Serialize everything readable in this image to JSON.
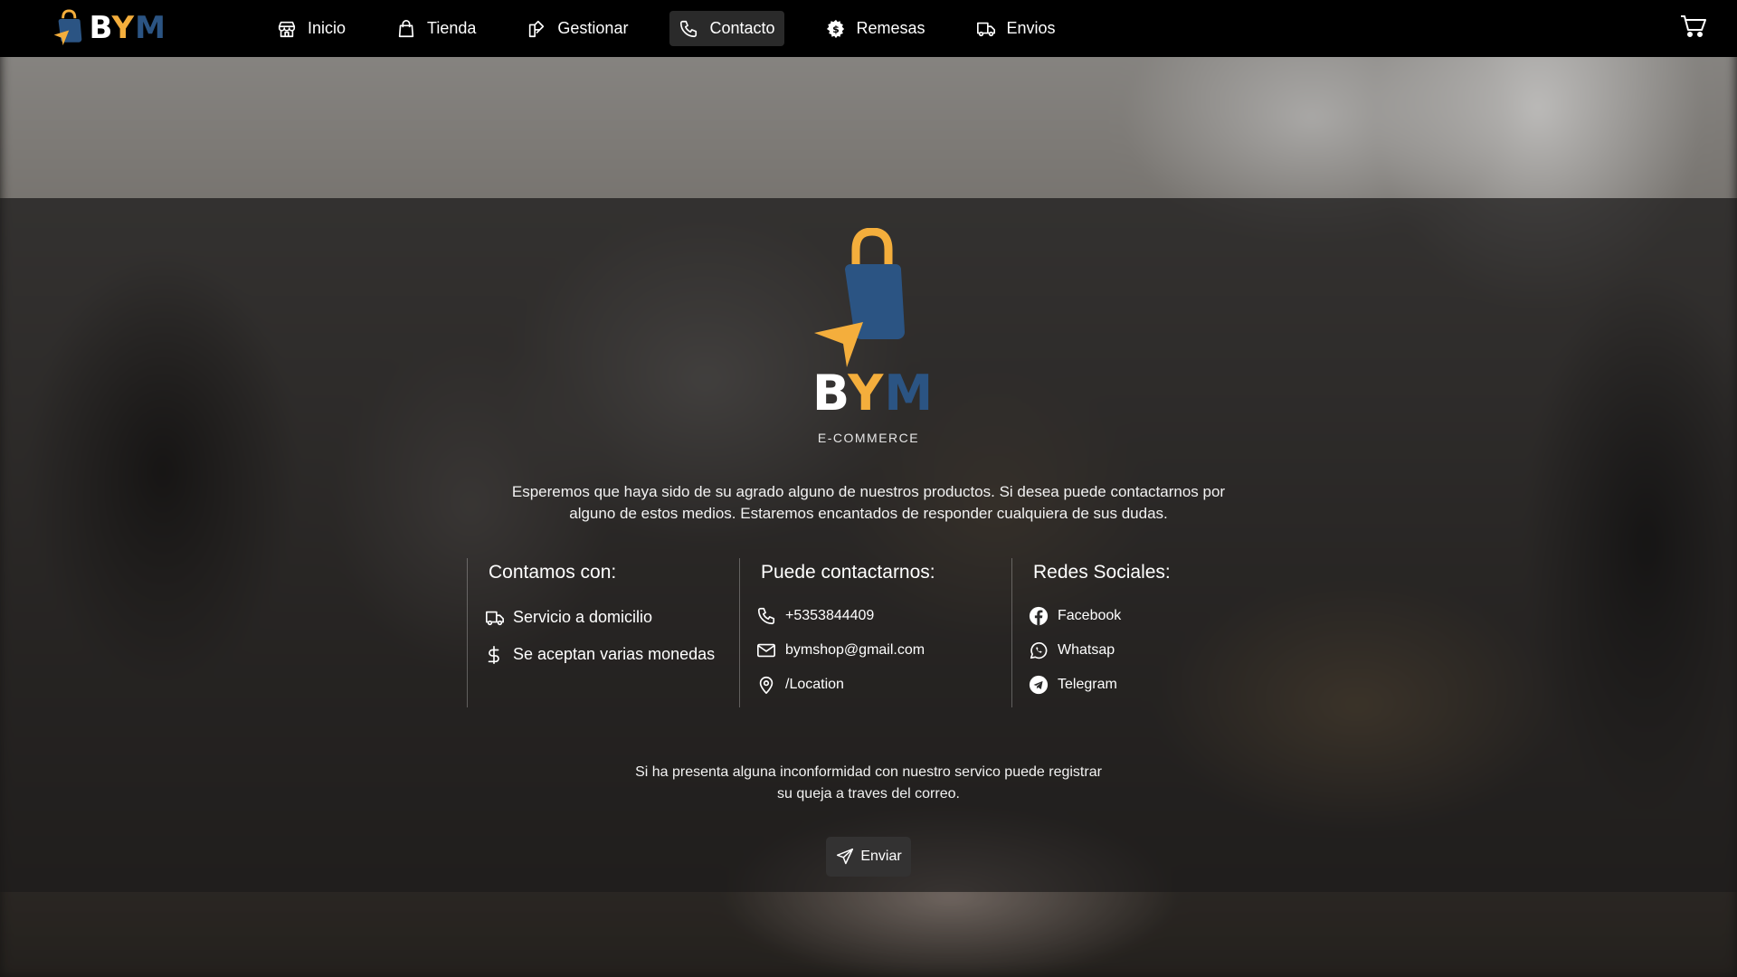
{
  "app": {
    "logo_letters": [
      "B",
      "Y",
      "M"
    ]
  },
  "nav": {
    "items": [
      {
        "label": "Inicio",
        "icon": "store-icon",
        "active": false
      },
      {
        "label": "Tienda",
        "icon": "bag-icon",
        "active": false
      },
      {
        "label": "Gestionar",
        "icon": "manage-icon",
        "active": false
      },
      {
        "label": "Contacto",
        "icon": "phone-icon",
        "active": true
      },
      {
        "label": "Remesas",
        "icon": "currency-gear-icon",
        "active": false
      },
      {
        "label": "Envios",
        "icon": "truck-icon",
        "active": false
      }
    ],
    "cart_icon": "cart-icon"
  },
  "brand": {
    "letters": [
      "B",
      "Y",
      "M"
    ],
    "subtitle": "E-COMMERCE"
  },
  "intro": {
    "text": "Esperemos que haya sido de su agrado alguno de nuestros productos. Si desea puede contactarnos por alguno de estos medios. Estaremos encantados de responder cualquiera de sus dudas."
  },
  "services": {
    "title": "Contamos con:",
    "items": [
      {
        "label": "Servicio a domicilio",
        "icon": "truck-icon"
      },
      {
        "label": "Se aceptan varias monedas",
        "icon": "dollar-icon"
      }
    ]
  },
  "contact": {
    "title": "Puede contactarnos:",
    "items": [
      {
        "label": "+5353844409",
        "icon": "phone-icon"
      },
      {
        "label": "bymshop@gmail.com",
        "icon": "mail-icon"
      },
      {
        "label": "/Location",
        "icon": "location-icon"
      }
    ]
  },
  "social": {
    "title": "Redes Sociales:",
    "items": [
      {
        "label": "Facebook",
        "icon": "facebook-icon"
      },
      {
        "label": "Whatsap",
        "icon": "whatsapp-icon"
      },
      {
        "label": "Telegram",
        "icon": "telegram-icon"
      }
    ]
  },
  "complaint": {
    "text": "Si ha presenta alguna inconformidad con nuestro servico puede registrar su queja a traves del correo."
  },
  "send_button": {
    "label": "Enviar",
    "icon": "send-icon"
  },
  "colors": {
    "brand_blue": "#2b5483",
    "brand_yellow": "#f4ae3c",
    "navbar_bg": "#000000",
    "active_nav_bg": "#2a2a2a",
    "button_bg": "#333232"
  }
}
